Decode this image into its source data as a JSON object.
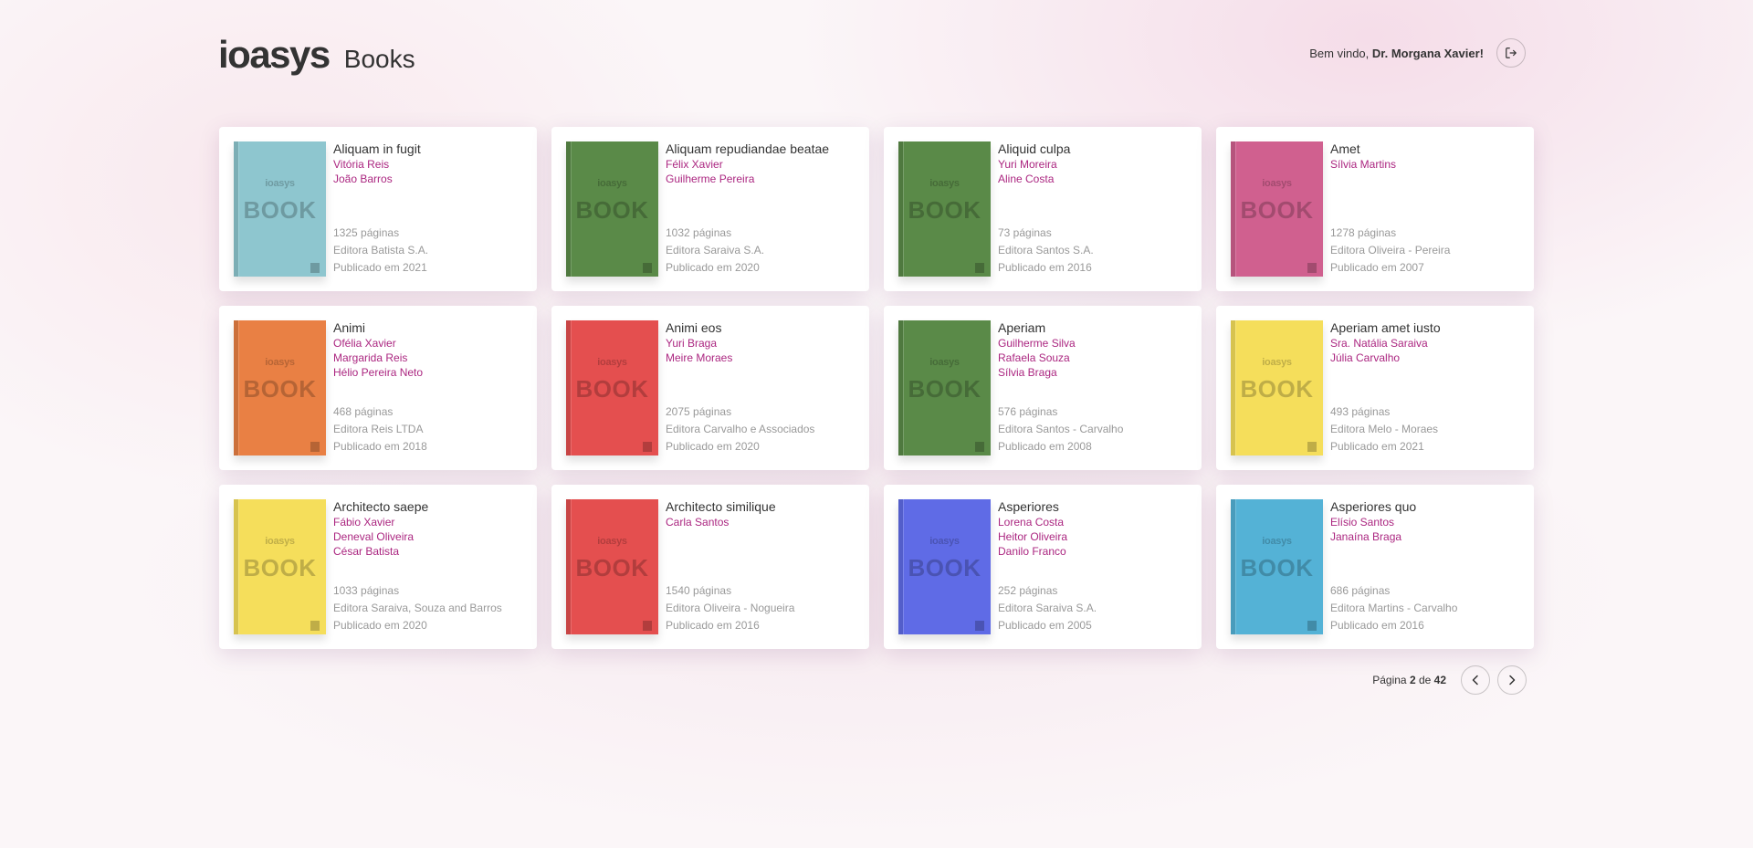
{
  "header": {
    "logo": "ioasys",
    "title": "Books",
    "welcome_prefix": "Bem vindo, ",
    "user_name": "Dr. Morgana Xavier!",
    "logout_icon": "logout-icon"
  },
  "cover": {
    "logo": "ioasys",
    "label": "BOOK"
  },
  "books": [
    {
      "title": "Aliquam in fugit",
      "authors": [
        "Vitória Reis",
        "João Barros"
      ],
      "pages": "1325 páginas",
      "publisher": "Editora Batista S.A.",
      "published": "Publicado em 2021",
      "color": "#8ec6cf"
    },
    {
      "title": "Aliquam repudiandae beatae",
      "authors": [
        "Félix Xavier",
        "Guilherme Pereira"
      ],
      "pages": "1032 páginas",
      "publisher": "Editora Saraiva S.A.",
      "published": "Publicado em 2020",
      "color": "#5a8a48"
    },
    {
      "title": "Aliquid culpa",
      "authors": [
        "Yuri Moreira",
        "Aline Costa"
      ],
      "pages": "73 páginas",
      "publisher": "Editora Santos S.A.",
      "published": "Publicado em 2016",
      "color": "#5a8a48"
    },
    {
      "title": "Amet",
      "authors": [
        "Sílvia Martins"
      ],
      "pages": "1278 páginas",
      "publisher": "Editora Oliveira - Pereira",
      "published": "Publicado em 2007",
      "color": "#d0608f"
    },
    {
      "title": "Animi",
      "authors": [
        "Ofélia Xavier",
        "Margarida Reis",
        "Hélio Pereira Neto"
      ],
      "pages": "468 páginas",
      "publisher": "Editora Reis LTDA",
      "published": "Publicado em 2018",
      "color": "#e98044"
    },
    {
      "title": "Animi eos",
      "authors": [
        "Yuri Braga",
        "Meire Moraes"
      ],
      "pages": "2075 páginas",
      "publisher": "Editora Carvalho e Associados",
      "published": "Publicado em 2020",
      "color": "#e44f4f"
    },
    {
      "title": "Aperiam",
      "authors": [
        "Guilherme Silva",
        "Rafaela Souza",
        "Sílvia Braga"
      ],
      "pages": "576 páginas",
      "publisher": "Editora Santos - Carvalho",
      "published": "Publicado em 2008",
      "color": "#5a8a48"
    },
    {
      "title": "Aperiam amet iusto",
      "authors": [
        "Sra. Natália Saraiva",
        "Júlia Carvalho"
      ],
      "pages": "493 páginas",
      "publisher": "Editora Melo - Moraes",
      "published": "Publicado em 2021",
      "color": "#f5de5b"
    },
    {
      "title": "Architecto saepe",
      "authors": [
        "Fábio Xavier",
        "Deneval Oliveira",
        "César Batista"
      ],
      "pages": "1033 páginas",
      "publisher": "Editora Saraiva, Souza and Barros",
      "published": "Publicado em 2020",
      "color": "#f5de5b"
    },
    {
      "title": "Architecto similique",
      "authors": [
        "Carla Santos"
      ],
      "pages": "1540 páginas",
      "publisher": "Editora Oliveira - Nogueira",
      "published": "Publicado em 2016",
      "color": "#e44f4f"
    },
    {
      "title": "Asperiores",
      "authors": [
        "Lorena Costa",
        "Heitor Oliveira",
        "Danilo Franco"
      ],
      "pages": "252 páginas",
      "publisher": "Editora Saraiva S.A.",
      "published": "Publicado em 2005",
      "color": "#5f6be6"
    },
    {
      "title": "Asperiores quo",
      "authors": [
        "Elísio Santos",
        "Janaína Braga"
      ],
      "pages": "686 páginas",
      "publisher": "Editora Martins - Carvalho",
      "published": "Publicado em 2016",
      "color": "#54b2d6"
    }
  ],
  "pagination": {
    "prefix": "Página ",
    "current": "2",
    "separator": " de ",
    "total": "42",
    "prev_icon": "chevron-left-icon",
    "next_icon": "chevron-right-icon"
  }
}
